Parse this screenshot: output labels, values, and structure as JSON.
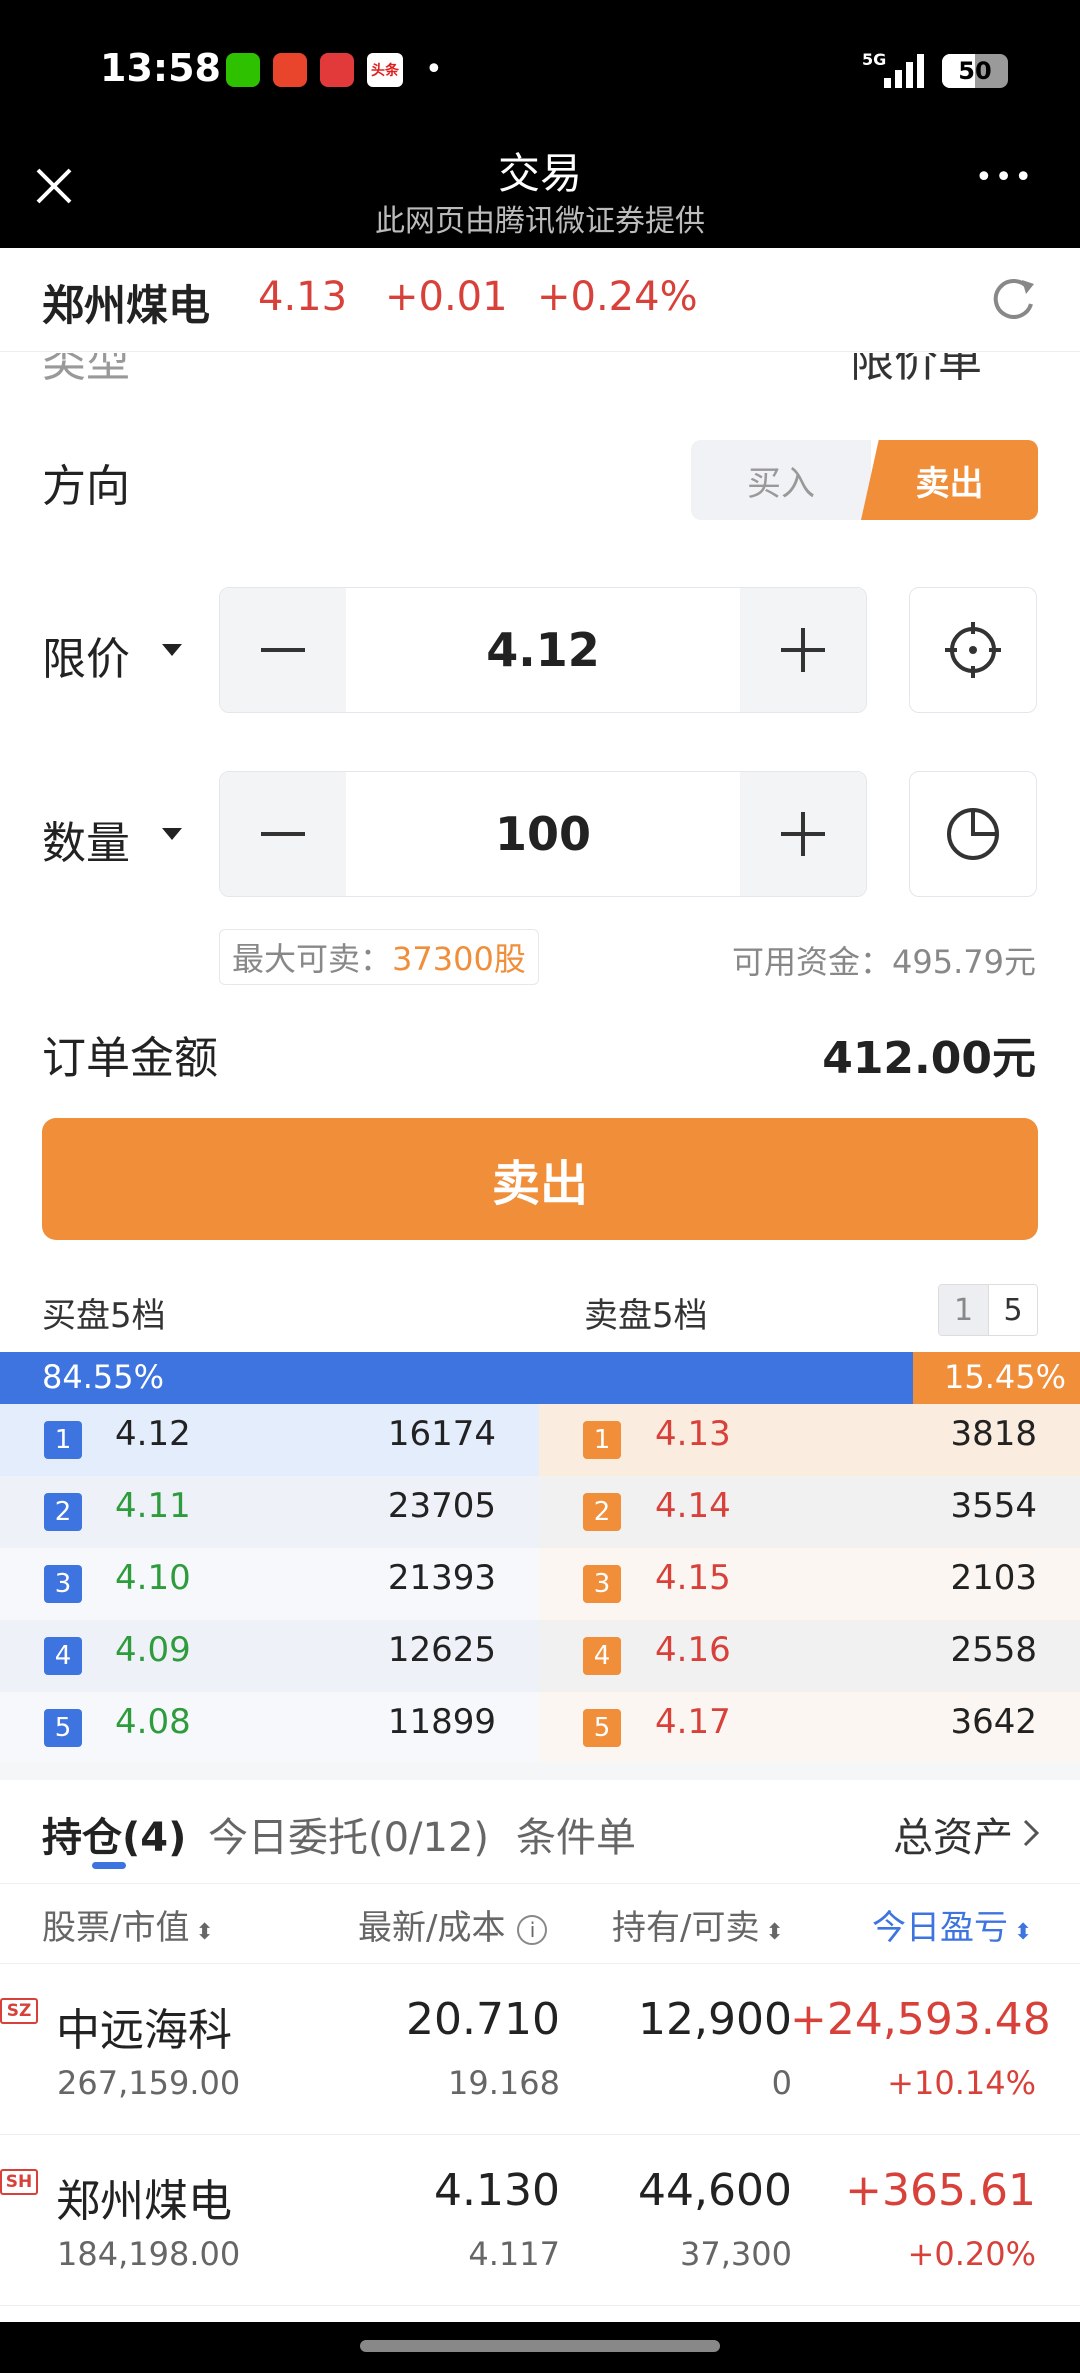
{
  "status_bar": {
    "time": "13:58",
    "app_icons": [
      "wechat-icon",
      "telegram-like-icon",
      "weibo-icon",
      "toutiao-icon"
    ],
    "toutiao_label": "头条",
    "dot": "•",
    "network": "5G",
    "battery": "50"
  },
  "nav": {
    "title": "交易",
    "subtitle": "此网页由腾讯微证券提供",
    "more": "•••"
  },
  "stock": {
    "name": "郑州煤电",
    "price": "4.13",
    "change": "+0.01",
    "change_pct": "+0.24%"
  },
  "order_type": {
    "label": "类型",
    "value": "限价单"
  },
  "direction": {
    "label": "方向",
    "buy": "买入",
    "sell": "卖出"
  },
  "price_row": {
    "label": "限价",
    "value": "4.12",
    "minus": "−",
    "plus": "+"
  },
  "qty_row": {
    "label": "数量",
    "value": "100",
    "minus": "−",
    "plus": "+"
  },
  "info": {
    "max_sell_label": "最大可卖：",
    "max_sell_value": "37300股",
    "available_label": "可用资金：",
    "available_value": "495.79元"
  },
  "order_amount": {
    "label": "订单金额",
    "value": "412.00元"
  },
  "submit": {
    "label": "卖出"
  },
  "orderbook": {
    "bid_title": "买盘5档",
    "ask_title": "卖盘5档",
    "toggle_1": "1",
    "toggle_5": "5",
    "bid_pct": "84.55%",
    "ask_pct": "15.45%",
    "bid_share": 0.8455,
    "bids": [
      {
        "level": "1",
        "price": "4.12",
        "volume": "16174"
      },
      {
        "level": "2",
        "price": "4.11",
        "volume": "23705"
      },
      {
        "level": "3",
        "price": "4.10",
        "volume": "21393"
      },
      {
        "level": "4",
        "price": "4.09",
        "volume": "12625"
      },
      {
        "level": "5",
        "price": "4.08",
        "volume": "11899"
      }
    ],
    "asks": [
      {
        "level": "1",
        "price": "4.13",
        "volume": "3818"
      },
      {
        "level": "2",
        "price": "4.14",
        "volume": "3554"
      },
      {
        "level": "3",
        "price": "4.15",
        "volume": "2103"
      },
      {
        "level": "4",
        "price": "4.16",
        "volume": "2558"
      },
      {
        "level": "5",
        "price": "4.17",
        "volume": "3642"
      }
    ]
  },
  "tabs": {
    "holdings": "持仓(4)",
    "today_orders": "今日委托(0/12)",
    "conditional": "条件单",
    "total_assets": "总资产"
  },
  "table_headers": {
    "stock_value": "股票/市值",
    "latest_cost": "最新/成本",
    "hold_sellable": "持有/可卖",
    "today_pnl": "今日盈亏"
  },
  "positions": [
    {
      "market": "SZ",
      "name": "中远海科",
      "value": "267,159.00",
      "latest": "20.710",
      "cost": "19.168",
      "hold": "12,900",
      "sellable": "0",
      "pnl": "+24,593.48",
      "pnl_pct": "+10.14%"
    },
    {
      "market": "SH",
      "name": "郑州煤电",
      "value": "184,198.00",
      "latest": "4.130",
      "cost": "4.117",
      "hold": "44,600",
      "sellable": "37,300",
      "pnl": "+365.61",
      "pnl_pct": "+0.20%"
    }
  ],
  "colors": {
    "accent_orange": "#F08E3A",
    "bid_blue": "#3D74E0",
    "up_red": "#D8413A",
    "down_green": "#2E9B3C"
  }
}
